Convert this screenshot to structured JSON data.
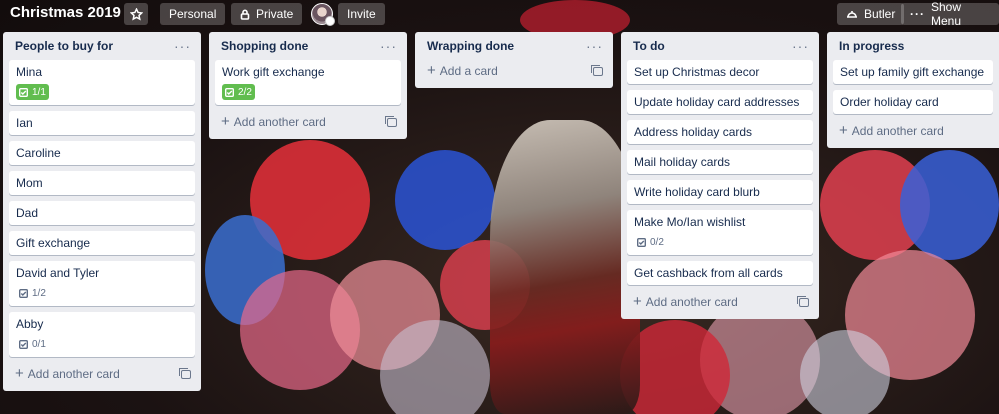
{
  "header": {
    "board_title": "Christmas 2019",
    "team_label": "Personal",
    "visibility_label": "Private",
    "invite_label": "Invite",
    "butler_label": "Butler",
    "show_menu_label": "Show Menu"
  },
  "lists": [
    {
      "title": "People to buy for",
      "cards": [
        {
          "title": "Mina",
          "checklist": "1/1",
          "complete": true
        },
        {
          "title": "Ian"
        },
        {
          "title": "Caroline"
        },
        {
          "title": "Mom"
        },
        {
          "title": "Dad"
        },
        {
          "title": "Gift exchange"
        },
        {
          "title": "David and Tyler",
          "checklist": "1/2",
          "complete": false
        },
        {
          "title": "Abby",
          "checklist": "0/1",
          "complete": false
        }
      ],
      "add_label": "Add another card"
    },
    {
      "title": "Shopping done",
      "cards": [
        {
          "title": "Work gift exchange",
          "checklist": "2/2",
          "complete": true
        }
      ],
      "add_label": "Add another card"
    },
    {
      "title": "Wrapping done",
      "cards": [],
      "add_label": "Add a card"
    },
    {
      "title": "To do",
      "cards": [
        {
          "title": "Set up Christmas decor"
        },
        {
          "title": "Update holiday card addresses"
        },
        {
          "title": "Address holiday cards"
        },
        {
          "title": "Mail holiday cards"
        },
        {
          "title": "Write holiday card blurb"
        },
        {
          "title": "Make Mo/Ian wishlist",
          "checklist": "0/2",
          "complete": false
        },
        {
          "title": "Get cashback from all cards"
        }
      ],
      "add_label": "Add another card"
    },
    {
      "title": "In progress",
      "cards": [
        {
          "title": "Set up family gift exchange"
        },
        {
          "title": "Order holiday card"
        }
      ],
      "add_label": "Add another card"
    }
  ],
  "colors": {
    "complete_badge": "#61bd4f",
    "list_bg": "#ebecf0",
    "card_text": "#172b4d"
  }
}
